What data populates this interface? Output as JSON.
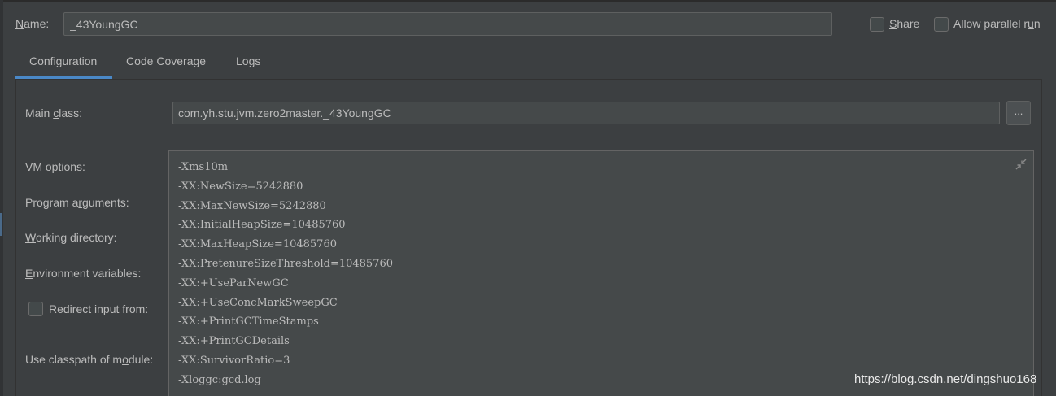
{
  "header": {
    "name_label": "Name:",
    "name_value": "_43YoungGC",
    "share_label": "Share",
    "allow_parallel_label": "Allow parallel run"
  },
  "tabs": [
    {
      "label": "Configuration",
      "active": true
    },
    {
      "label": "Code Coverage",
      "active": false
    },
    {
      "label": "Logs",
      "active": false
    }
  ],
  "form": {
    "main_class_label": "Main class:",
    "main_class_value": "com.yh.stu.jvm.zero2master._43YoungGC",
    "browse_label": "...",
    "vm_options_label": "VM options:",
    "program_arguments_label": "Program arguments:",
    "working_directory_label": "Working directory:",
    "environment_variables_label": "Environment variables:",
    "redirect_input_label": "Redirect input from:",
    "use_classpath_label": "Use classpath of module:",
    "vm_options_lines": [
      "-Xms10m",
      "-XX:NewSize=5242880",
      "-XX:MaxNewSize=5242880",
      "-XX:InitialHeapSize=10485760",
      "-XX:MaxHeapSize=10485760",
      "-XX:PretenureSizeThreshold=10485760",
      "-XX:+UseParNewGC",
      "-XX:+UseConcMarkSweepGC",
      "-XX:+PrintGCTimeStamps",
      "-XX:+PrintGCDetails",
      "-XX:SurvivorRatio=3",
      "-Xloggc:gcd.log"
    ]
  },
  "watermark": "https://blog.csdn.net/dingshuo168",
  "colors": {
    "background": "#3c3f41",
    "input_background": "#45494a",
    "text": "#bbbbbb",
    "accent": "#4a88c7"
  }
}
